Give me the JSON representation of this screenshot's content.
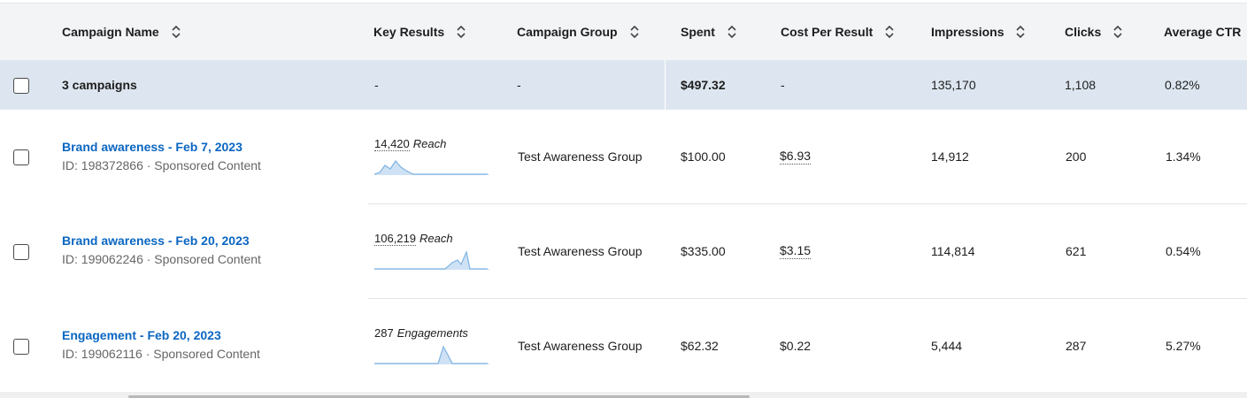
{
  "columns": {
    "campaign_name": "Campaign Name",
    "key_results": "Key Results",
    "campaign_group": "Campaign Group",
    "spent": "Spent",
    "cost_per_result": "Cost Per Result",
    "impressions": "Impressions",
    "clicks": "Clicks",
    "average_ctr": "Average CTR"
  },
  "summary": {
    "label": "3 campaigns",
    "key_results": "-",
    "campaign_group": "-",
    "spent": "$497.32",
    "cost_per_result": "-",
    "impressions": "135,170",
    "clicks": "1,108",
    "average_ctr": "0.82%"
  },
  "rows": [
    {
      "name": "Brand awareness - Feb 7, 2023",
      "meta": "ID: 198372866 · Sponsored Content",
      "key_result_value": "14,420",
      "key_result_unit": "Reach",
      "campaign_group": "Test Awareness Group",
      "spent": "$100.00",
      "cost_per_result": "$6.93",
      "impressions": "14,912",
      "clicks": "200",
      "average_ctr": "1.34%"
    },
    {
      "name": "Brand awareness - Feb 20, 2023",
      "meta": "ID: 199062246 · Sponsored Content",
      "key_result_value": "106,219",
      "key_result_unit": "Reach",
      "campaign_group": "Test Awareness Group",
      "spent": "$335.00",
      "cost_per_result": "$3.15",
      "impressions": "114,814",
      "clicks": "621",
      "average_ctr": "0.54%"
    },
    {
      "name": "Engagement - Feb 20, 2023",
      "meta": "ID: 199062116 · Sponsored Content",
      "key_result_value": "287",
      "key_result_unit": "Engagements",
      "campaign_group": "Test Awareness Group",
      "spent": "$62.32",
      "cost_per_result": "$0.22",
      "impressions": "5,444",
      "clicks": "287",
      "average_ctr": "5.27%"
    }
  ],
  "icons": {
    "sort": "sort-icon",
    "checkbox": "checkbox"
  },
  "colors": {
    "link": "#0a66c2",
    "header_bg": "#f3f4f6",
    "summary_bg": "#dde6f0",
    "sparkline": "#7fb3e3"
  }
}
